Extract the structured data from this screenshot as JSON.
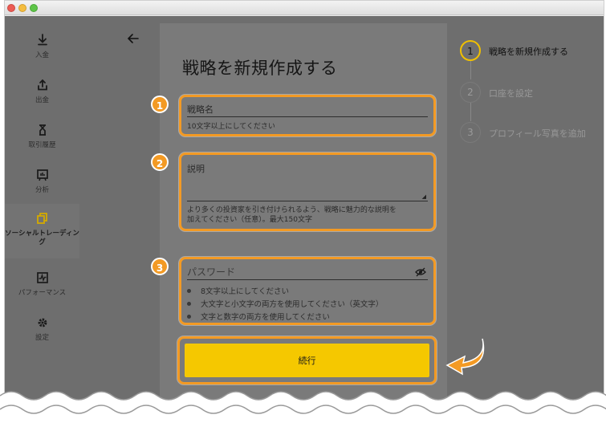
{
  "sidebar": {
    "items": [
      {
        "label": "入金",
        "icon": "download-icon"
      },
      {
        "label": "出金",
        "icon": "upload-icon"
      },
      {
        "label": "取引履歴",
        "icon": "hourglass-icon"
      },
      {
        "label": "分析",
        "icon": "presentation-icon"
      },
      {
        "label": "ソーシャルトレーディング",
        "icon": "copy-icon",
        "active": true
      },
      {
        "label": "パフォーマンス",
        "icon": "chart-icon"
      },
      {
        "label": "設定",
        "icon": "gear-icon"
      }
    ]
  },
  "page": {
    "title": "戦略を新規作成する",
    "back_icon": "arrow-left-icon"
  },
  "form": {
    "strategy_name": {
      "label": "戦略名",
      "helper": "10文字以上にしてください",
      "badge": "1",
      "value": ""
    },
    "description": {
      "label": "説明",
      "helper_line1": "より多くの投資家を引き付けられるよう、戦略に魅力的な説明を",
      "helper_line2": "加えてください（任意）。最大150文字",
      "badge": "2",
      "value": ""
    },
    "password": {
      "placeholder": "パスワード",
      "badge": "3",
      "rules": [
        "8文字以上にしてください",
        "大文字と小文字の両方を使用してください（英文字）",
        "文字と数字の両方を使用してください"
      ]
    },
    "continue_label": "続行"
  },
  "steps": [
    {
      "number": "1",
      "label": "戦略を新規作成する",
      "active": true
    },
    {
      "number": "2",
      "label": "口座を設定",
      "active": false
    },
    {
      "number": "3",
      "label": "プロフィール写真を追加",
      "active": false
    }
  ],
  "colors": {
    "accent": "#f39a24",
    "button": "#f5c800",
    "overlay": "#6e6e6e"
  }
}
